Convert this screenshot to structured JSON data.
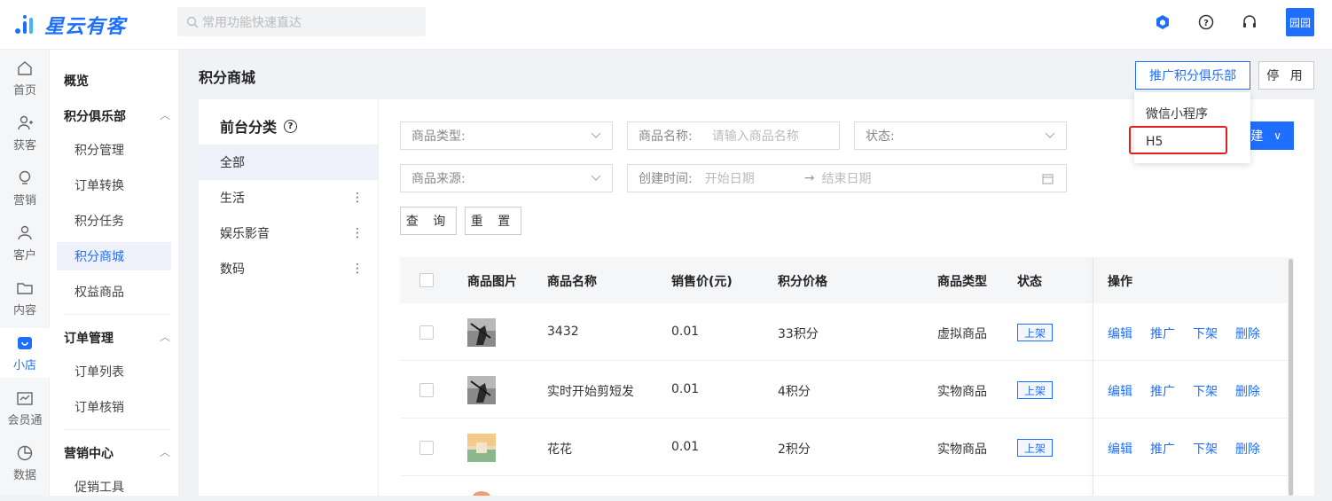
{
  "header": {
    "logo_text": "星云有客",
    "search_placeholder": "常用功能快速直达",
    "avatar_text": "园园"
  },
  "rail": [
    {
      "label": "首页",
      "icon": "home-icon"
    },
    {
      "label": "获客",
      "icon": "user-add-icon"
    },
    {
      "label": "营销",
      "icon": "bulb-icon"
    },
    {
      "label": "客户",
      "icon": "person-icon"
    },
    {
      "label": "内容",
      "icon": "folder-icon"
    },
    {
      "label": "小店",
      "icon": "shop-icon"
    },
    {
      "label": "会员通",
      "icon": "crown-icon"
    },
    {
      "label": "数据",
      "icon": "pie-chart-icon"
    }
  ],
  "menu": {
    "overview": "概览",
    "group1": "积分俱乐部",
    "group1_items": [
      "积分管理",
      "订单转换",
      "积分任务",
      "积分商城",
      "权益商品"
    ],
    "group2": "订单管理",
    "group2_items": [
      "订单列表",
      "订单核销"
    ],
    "group3": "营销中心",
    "group3_items": [
      "促销工具"
    ]
  },
  "page": {
    "title": "积分商城",
    "promote_btn": "推广积分俱乐部",
    "disable_btn": "停 用"
  },
  "dropdown": {
    "items": [
      "微信小程序",
      "H5"
    ]
  },
  "category": {
    "title": "前台分类",
    "items": [
      "全部",
      "生活",
      "娱乐影音",
      "数码"
    ]
  },
  "filters": {
    "type_label": "商品类型:",
    "name_label": "商品名称:",
    "name_placeholder": "请输入商品名称",
    "status_label": "状态:",
    "source_label": "商品来源:",
    "time_label": "创建时间:",
    "start_placeholder": "开始日期",
    "end_placeholder": "结束日期",
    "query_btn": "查 询",
    "reset_btn": "重 置",
    "new_btn": "建"
  },
  "table": {
    "headers": [
      "商品图片",
      "商品名称",
      "销售价(元)",
      "积分价格",
      "商品类型",
      "状态",
      "操作"
    ],
    "rows": [
      {
        "name": "3432",
        "price": "0.01",
        "points": "33积分",
        "type": "虚拟商品",
        "status": "上架"
      },
      {
        "name": "实时开始剪短发",
        "price": "0.01",
        "points": "4积分",
        "type": "实物商品",
        "status": "上架"
      },
      {
        "name": "花花",
        "price": "0.01",
        "points": "2积分",
        "type": "实物商品",
        "status": "上架"
      }
    ],
    "ops": [
      "编辑",
      "推广",
      "下架",
      "删除"
    ]
  }
}
